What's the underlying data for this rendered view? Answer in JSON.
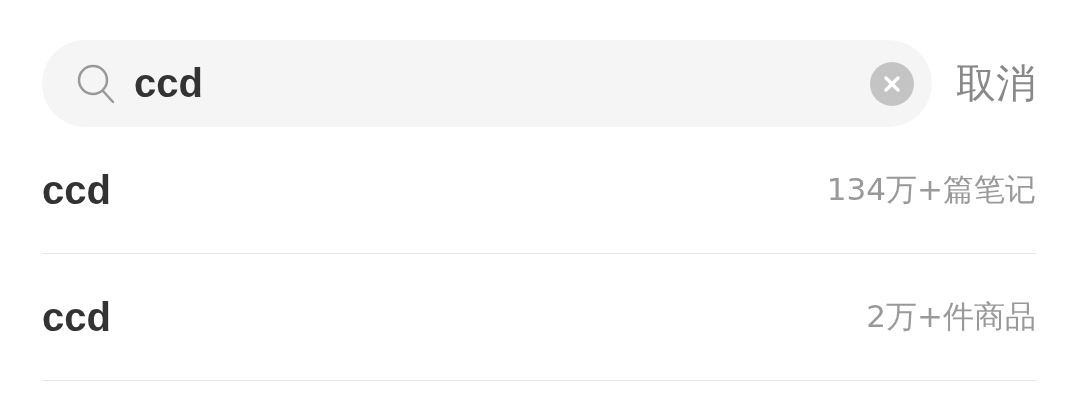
{
  "search": {
    "value": "ccd",
    "cancel": "取消"
  },
  "suggestions": [
    {
      "term": "ccd",
      "count": "134万+篇笔记"
    },
    {
      "term": "ccd",
      "count": "2万+件商品"
    }
  ]
}
